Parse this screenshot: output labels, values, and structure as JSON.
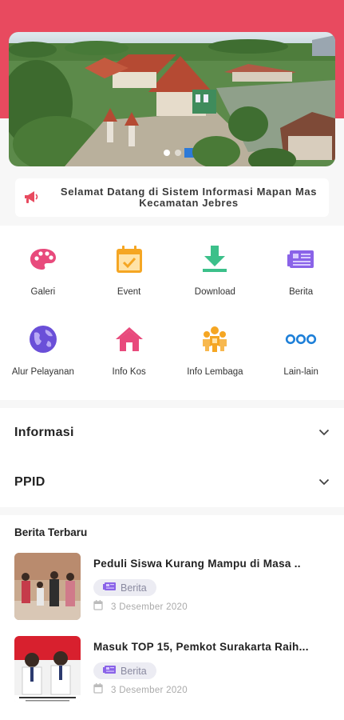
{
  "hero": {
    "image_desc_icon": "aerial-town-photo",
    "slide_count": 2,
    "active_slide": 1
  },
  "welcome": {
    "text": "Selamat Datang di Sistem Informasi Mapan Mas Kecamatan Jebres",
    "icon": "megaphone-icon"
  },
  "menu": {
    "items": [
      {
        "label": "Galeri",
        "icon": "palette-icon",
        "color": "#e84a7c"
      },
      {
        "label": "Event",
        "icon": "calendar-check-icon",
        "color": "#f5a623"
      },
      {
        "label": "Download",
        "icon": "download-icon",
        "color": "#3cc08a"
      },
      {
        "label": "Berita",
        "icon": "news-icon",
        "color": "#8a63e8"
      },
      {
        "label": "Alur Pelayanan",
        "icon": "globe-icon",
        "color": "#6a4fd8"
      },
      {
        "label": "Info Kos",
        "icon": "house-icon",
        "color": "#e84a7c"
      },
      {
        "label": "Info Lembaga",
        "icon": "people-icon",
        "color": "#f5a623"
      },
      {
        "label": "Lain-lain",
        "icon": "more-dots-icon",
        "color": "#1d7fd8"
      }
    ]
  },
  "accordion": {
    "items": [
      {
        "label": "Informasi"
      },
      {
        "label": "PPID"
      }
    ]
  },
  "news": {
    "heading": "Berita Terbaru",
    "items": [
      {
        "title": "Peduli Siswa Kurang Mampu di Masa ..",
        "category": "Berita",
        "date": "3 Desember 2020"
      },
      {
        "title": "Masuk TOP 15, Pemkot Surakarta Raih...",
        "category": "Berita",
        "date": "3 Desember 2020"
      }
    ]
  },
  "colors": {
    "brand": "#e84a5f",
    "badge_bg": "#ececf3",
    "badge_text": "#8a8aa0"
  }
}
